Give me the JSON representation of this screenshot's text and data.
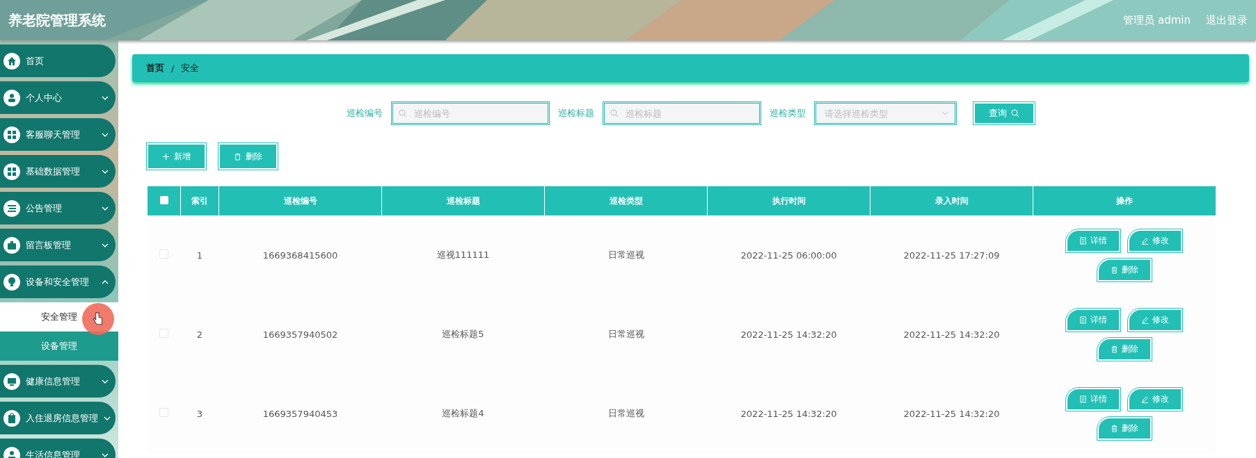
{
  "header": {
    "title": "养老院管理系统",
    "user": "管理员 admin",
    "logout": "退出登录"
  },
  "sidebar": {
    "items": [
      {
        "label": "首页",
        "expandable": false
      },
      {
        "label": "个人中心",
        "expandable": true,
        "expanded": false
      },
      {
        "label": "客服聊天管理",
        "expandable": true,
        "expanded": false
      },
      {
        "label": "基础数据管理",
        "expandable": true,
        "expanded": false
      },
      {
        "label": "公告管理",
        "expandable": true,
        "expanded": false
      },
      {
        "label": "留言板管理",
        "expandable": true,
        "expanded": false
      },
      {
        "label": "设备和安全管理",
        "expandable": true,
        "expanded": true,
        "children": [
          {
            "label": "安全管理",
            "selected": true
          },
          {
            "label": "设备管理",
            "selected": false
          }
        ]
      },
      {
        "label": "健康信息管理",
        "expandable": true,
        "expanded": false
      },
      {
        "label": "入住退房信息管理",
        "expandable": true,
        "expanded": false
      },
      {
        "label": "生活信息管理",
        "expandable": true,
        "expanded": false
      }
    ]
  },
  "breadcrumb": [
    "首页",
    "/",
    "安全"
  ],
  "search": {
    "fields": [
      {
        "kind": "input",
        "label": "巡检编号",
        "placeholder": "巡检编号"
      },
      {
        "kind": "input",
        "label": "巡检标题",
        "placeholder": "巡检标题"
      },
      {
        "kind": "select",
        "label": "巡检类型",
        "placeholder": "请选择巡检类型"
      }
    ],
    "button": "查询"
  },
  "actions": [
    "新增",
    "删除"
  ],
  "table": {
    "columns": [
      "索引",
      "巡检编号",
      "巡检标题",
      "巡检类型",
      "执行时间",
      "录入时间",
      "操作"
    ],
    "header_checked": false,
    "rows": [
      {
        "checked": false,
        "cells": [
          "1",
          "1669368415600",
          "巡视111111",
          "日常巡视",
          "2022-11-25 06:00:00",
          "2022-11-25 17:27:09"
        ],
        "actions": [
          "详情",
          "修改",
          "删除"
        ]
      },
      {
        "checked": false,
        "cells": [
          "2",
          "1669357940502",
          "巡检标题5",
          "日常巡视",
          "2022-11-25 14:32:20",
          "2022-11-25 14:32:20"
        ],
        "actions": [
          "详情",
          "修改",
          "删除"
        ]
      },
      {
        "checked": false,
        "cells": [
          "3",
          "1669357940453",
          "巡检标题4",
          "日常巡视",
          "2022-11-25 14:32:20",
          "2022-11-25 14:32:20"
        ],
        "actions": [
          "详情",
          "修改",
          "删除"
        ]
      }
    ]
  }
}
